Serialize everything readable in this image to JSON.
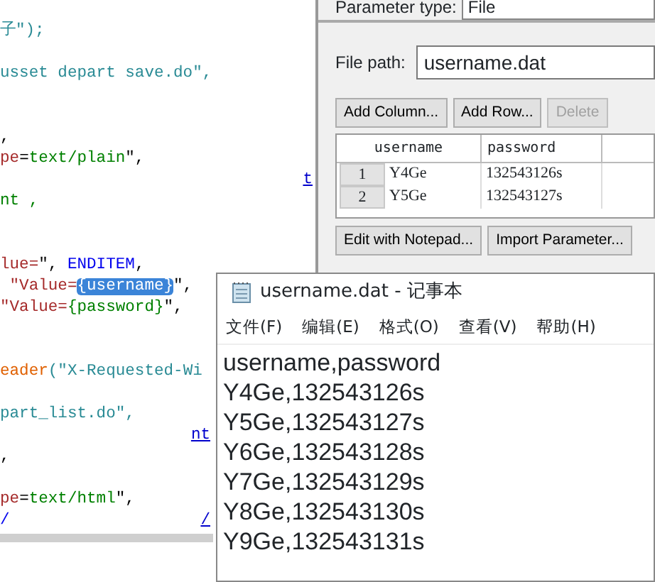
{
  "code_editor": {
    "blocks": [
      {
        "lines": [
          {
            "segments": [
              {
                "text": "子\");",
                "kind": "string"
              }
            ]
          }
        ]
      },
      {
        "lines": [
          {
            "segments": [
              {
                "text": "usset depart save.do\",",
                "kind": "string"
              }
            ]
          }
        ]
      },
      {
        "lines": [
          {
            "segments": [
              {
                "text": ",",
                "kind": "plain"
              }
            ]
          },
          {
            "segments": [
              {
                "text": "pe",
                "kind": "attr"
              },
              {
                "text": "=",
                "kind": "plain"
              },
              {
                "text": "text/plain",
                "kind": "value"
              },
              {
                "text": "\",",
                "kind": "plain"
              }
            ]
          },
          {
            "aside": "t"
          },
          {
            "segments": [
              {
                "text": "nt ,",
                "kind": "value"
              }
            ]
          }
        ]
      },
      {
        "lines": [
          {
            "segments": [
              {
                "text": "lue=",
                "kind": "attr"
              },
              {
                "text": "\", ",
                "kind": "plain"
              },
              {
                "text": "ENDITEM",
                "kind": "keyword"
              },
              {
                "text": ",",
                "kind": "plain"
              }
            ]
          },
          {
            "segments": [
              {
                "text": " \"Value=",
                "kind": "attr"
              },
              {
                "text": "{username}",
                "kind": "highlight"
              },
              {
                "text": "\",",
                "kind": "plain"
              }
            ]
          },
          {
            "segments": [
              {
                "text": "\"Value=",
                "kind": "attr"
              },
              {
                "text": "{password}",
                "kind": "value"
              },
              {
                "text": "\",",
                "kind": "plain"
              }
            ]
          }
        ]
      },
      {
        "lines": [
          {
            "segments": [
              {
                "text": "eader",
                "kind": "func"
              },
              {
                "text": "(\"X-Requested-Wi",
                "kind": "string"
              }
            ]
          }
        ]
      },
      {
        "lines": [
          {
            "segments": [
              {
                "text": "part_list.do\",",
                "kind": "string"
              }
            ]
          },
          {
            "aside": "nt"
          },
          {
            "segments": [
              {
                "text": ",",
                "kind": "plain"
              }
            ]
          }
        ]
      },
      {
        "lines": [
          {
            "segments": [
              {
                "text": "pe",
                "kind": "attr"
              },
              {
                "text": "=",
                "kind": "plain"
              },
              {
                "text": "text/html",
                "kind": "value"
              },
              {
                "text": "\",",
                "kind": "plain"
              }
            ]
          },
          {
            "segments": [
              {
                "text": "/",
                "kind": "keyword"
              }
            ],
            "aside": "/"
          }
        ]
      }
    ]
  },
  "parameter_dialog": {
    "type_label": "Parameter type:",
    "type_value": "File",
    "path_label": "File path:",
    "path_value": "username.dat",
    "buttons": [
      {
        "label": "Add Column...",
        "disabled": false
      },
      {
        "label": "Add Row...",
        "disabled": false
      },
      {
        "label": "Delete",
        "disabled": true
      }
    ],
    "table": {
      "columns": [
        "username",
        "password"
      ],
      "rows": [
        {
          "number": "1",
          "cells": [
            "Y4Ge",
            "132543126s"
          ]
        },
        {
          "number": "2",
          "cells": [
            "Y5Ge",
            "132543127s"
          ]
        }
      ]
    },
    "bottom_buttons": [
      "Edit with Notepad...",
      "Import Parameter..."
    ]
  },
  "notepad": {
    "title": "username.dat - 记事本",
    "menu": [
      "文件(F)",
      "编辑(E)",
      "格式(O)",
      "查看(V)",
      "帮助(H)"
    ],
    "lines": [
      "username,password",
      "Y4Ge,132543126s",
      "Y5Ge,132543127s",
      "Y6Ge,132543128s",
      "Y7Ge,132543129s",
      "Y8Ge,132543130s",
      "Y9Ge,132543131s"
    ]
  }
}
